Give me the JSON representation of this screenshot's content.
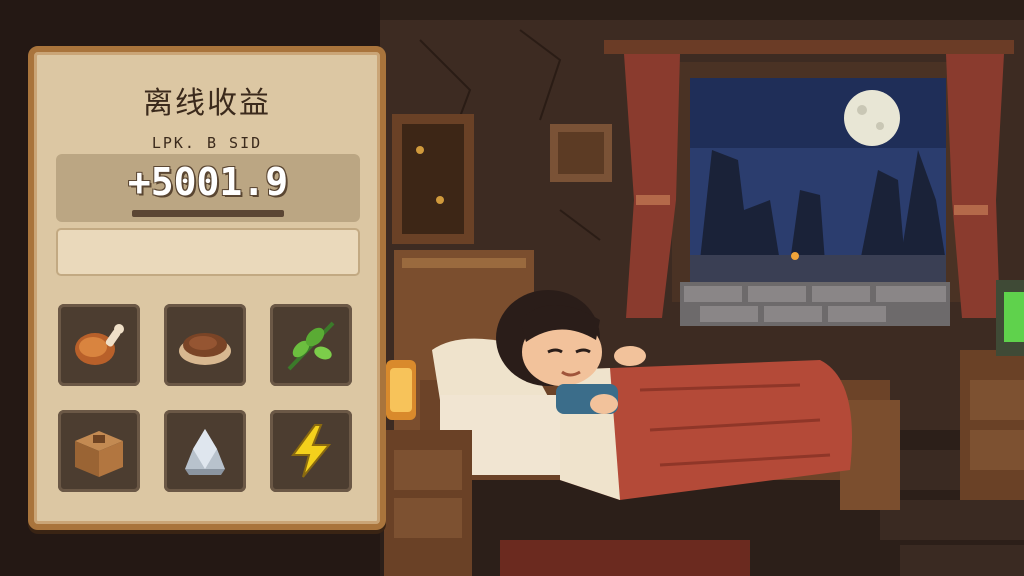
{
  "offline_panel": {
    "title": "离线收益",
    "subtitle": "LPK. B SID",
    "amount": "+5001.9",
    "items": [
      {
        "icon": "meat-icon"
      },
      {
        "icon": "bread-icon"
      },
      {
        "icon": "herb-leaf-icon"
      },
      {
        "icon": "wooden-crate-icon"
      },
      {
        "icon": "silver-ore-icon"
      },
      {
        "icon": "lightning-energy-icon"
      }
    ]
  },
  "colors": {
    "panel_bg": "#dcc7a3",
    "panel_border": "#a9743c",
    "slot_bg": "#4c3d30",
    "blanket": "#b44a38",
    "night_sky": "#2b3d6e"
  }
}
